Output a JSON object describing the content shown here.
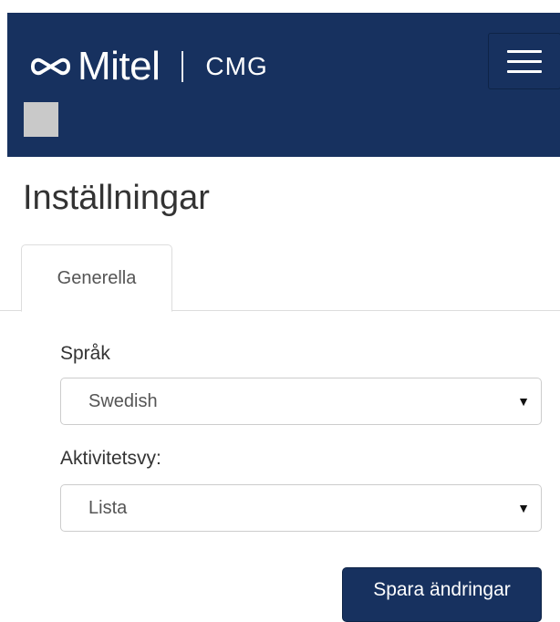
{
  "header": {
    "brand": "Mitel",
    "product": "CMG",
    "colors": {
      "background": "#17315f",
      "text": "#ffffff"
    },
    "menu_icon": "hamburger-icon"
  },
  "page": {
    "title": "Inställningar"
  },
  "tabs": [
    {
      "label": "Generella",
      "active": true
    }
  ],
  "form": {
    "language": {
      "label": "Språk",
      "value": "Swedish"
    },
    "activity_view": {
      "label": "Aktivitetsvy:",
      "value": "Lista"
    }
  },
  "actions": {
    "save_label": "Spara ändringar"
  },
  "icons": {
    "logo": "mitel-logo-icon",
    "caret": "caret-down-icon",
    "user": "user-avatar-placeholder"
  }
}
